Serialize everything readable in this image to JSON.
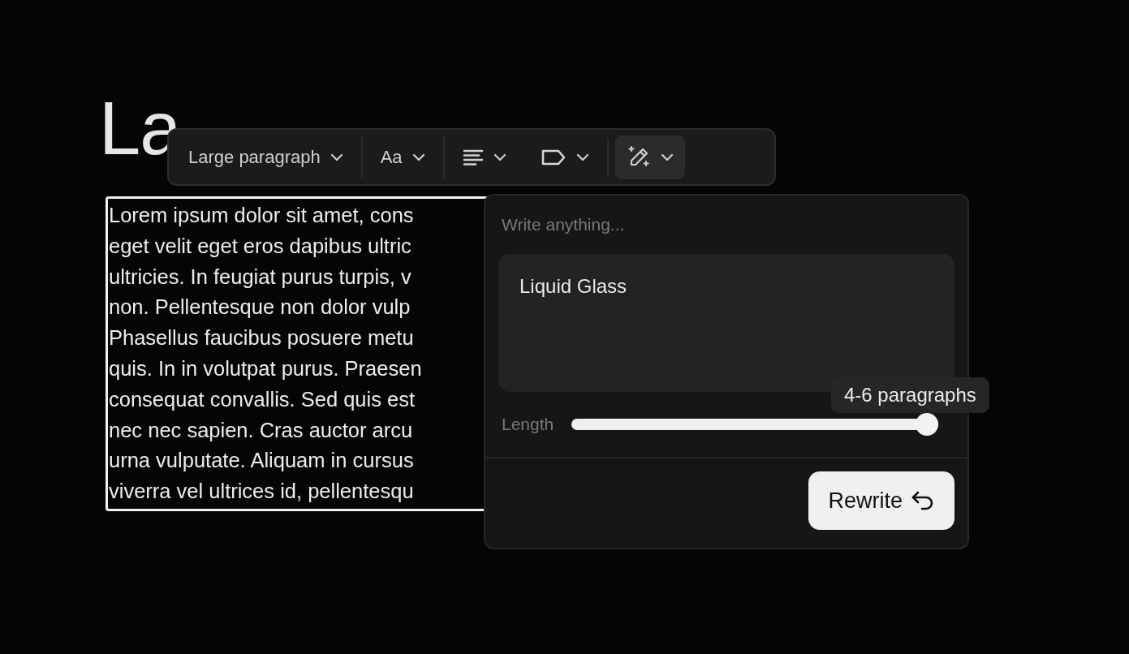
{
  "heading": "La",
  "paragraph_lines": [
    "Lorem ipsum dolor sit amet, cons",
    "eget velit eget eros dapibus ultric",
    "ultricies. In feugiat purus turpis, v",
    "non. Pellentesque non dolor vulp",
    "Phasellus faucibus posuere metu",
    "quis. In in volutpat purus. Praesen",
    "consequat convallis. Sed quis est",
    "nec nec sapien. Cras auctor arcu",
    "urna vulputate. Aliquam in cursus",
    "viverra vel ultrices id, pellentesqu"
  ],
  "toolbar": [
    {
      "kind": "text",
      "label": "Large paragraph",
      "selected": false
    },
    {
      "kind": "text",
      "label": "Aa",
      "selected": false
    },
    {
      "kind": "align",
      "selected": false
    },
    {
      "kind": "tag",
      "selected": false
    },
    {
      "kind": "ai",
      "selected": true
    }
  ],
  "popover": {
    "prompt": {
      "placeholder": "Write anything..."
    },
    "input": {
      "value": "Liquid Glass"
    },
    "length": {
      "label": "Length",
      "level": 1,
      "tooltip": "4-6 paragraphs"
    },
    "button": "Rewrite"
  }
}
